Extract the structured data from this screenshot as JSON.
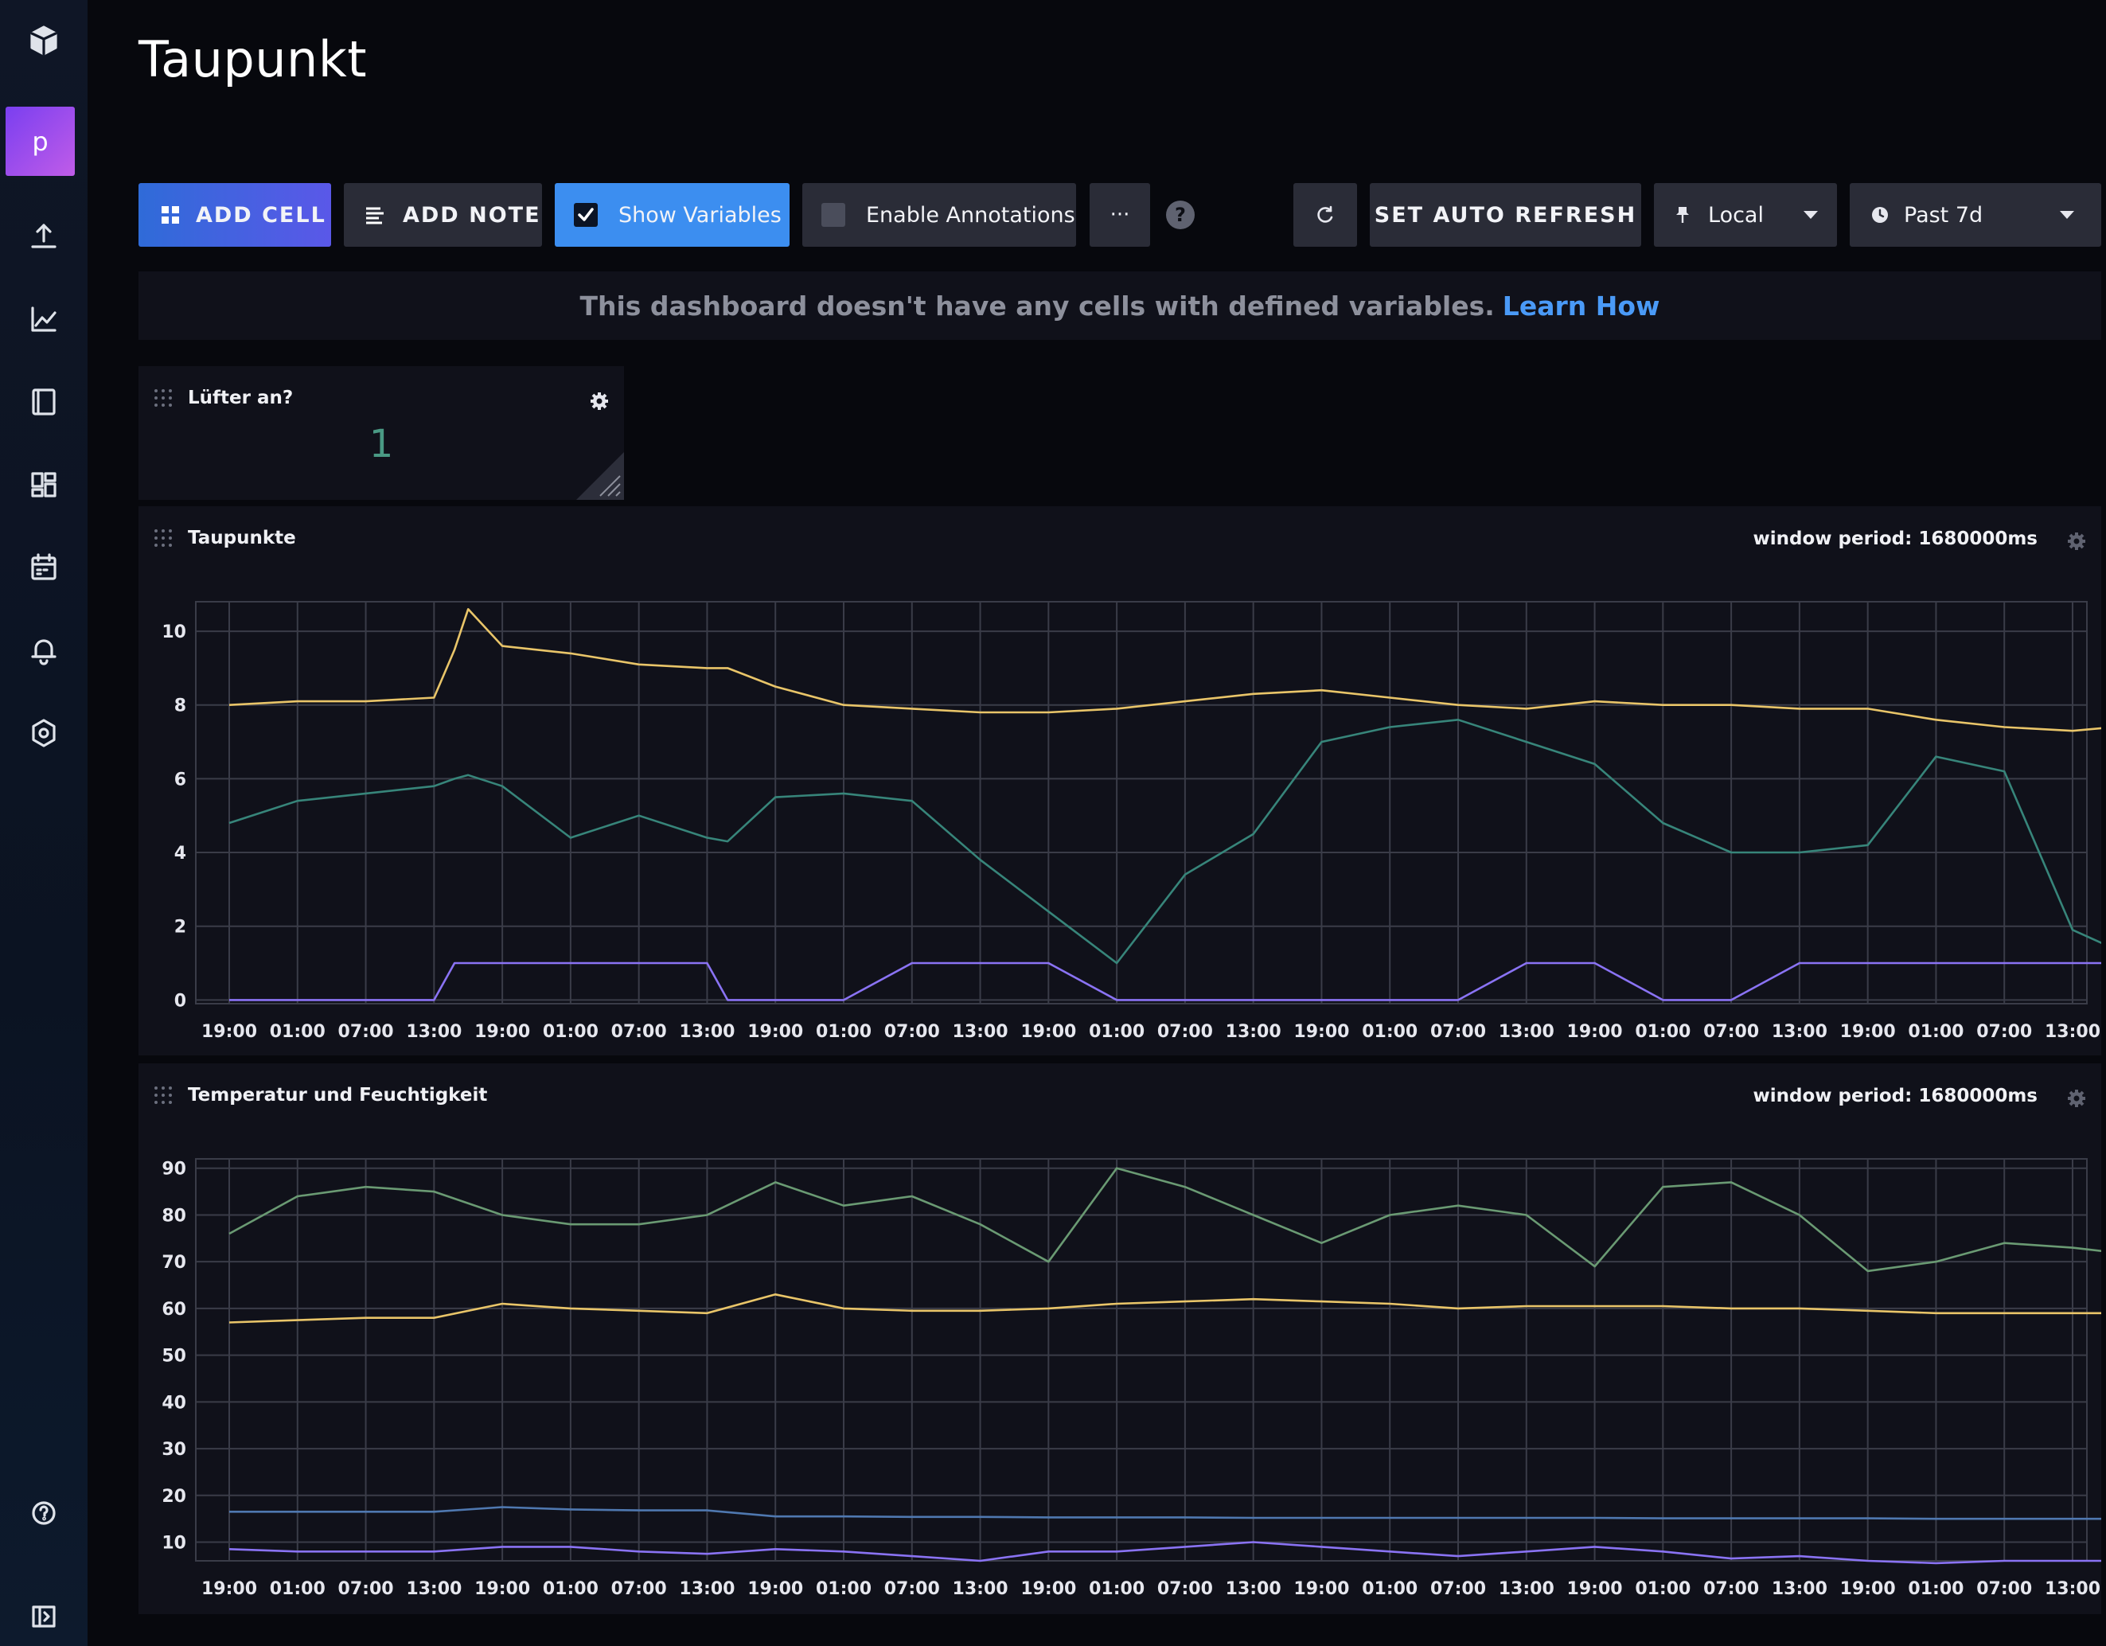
{
  "page": {
    "title": "Taupunkt"
  },
  "sidebar": {
    "org_initial": "p",
    "items": [
      {
        "name": "logo",
        "icon": "influx-logo-icon"
      },
      {
        "name": "data",
        "icon": "upload-icon"
      },
      {
        "name": "explore",
        "icon": "graph-icon"
      },
      {
        "name": "notebooks",
        "icon": "book-icon"
      },
      {
        "name": "dashboards",
        "icon": "dashboards-icon"
      },
      {
        "name": "tasks",
        "icon": "calendar-icon"
      },
      {
        "name": "alerts",
        "icon": "bell-icon"
      },
      {
        "name": "settings",
        "icon": "gear-icon"
      },
      {
        "name": "help",
        "icon": "help-icon"
      },
      {
        "name": "collapse",
        "icon": "sidebar-collapse-icon"
      }
    ]
  },
  "toolbar": {
    "add_cell": "ADD CELL",
    "add_note": "ADD NOTE",
    "show_variables": "Show Variables",
    "show_variables_checked": true,
    "enable_annotations": "Enable Annotations",
    "enable_annotations_checked": false,
    "more": "···",
    "help": "?",
    "auto_refresh": "SET AUTO REFRESH",
    "timezone": "Local",
    "time_range": "Past 7d"
  },
  "notice": {
    "text": "This dashboard doesn't have any cells with defined variables.",
    "link": "Learn How"
  },
  "cells": {
    "fan": {
      "title": "Lüfter an?",
      "value": "1",
      "value_color": "#4a9a84"
    },
    "dew": {
      "title": "Taupunkte",
      "window_period": "window period: 1680000ms"
    },
    "temp": {
      "title": "Temperatur und Feuchtigkeit",
      "window_period": "window period: 1680000ms"
    }
  },
  "colors": {
    "yellow": "#e9c569",
    "teal": "#37857a",
    "purple": "#8a73f4",
    "green": "#6a9a73",
    "blue": "#4f78b0",
    "grid": "#3a3c48",
    "axis_text": "#e6e7ee"
  },
  "chart_data": [
    {
      "type": "line",
      "title": "Taupunkte",
      "xlabel": "",
      "ylabel": "",
      "x_ticks": [
        "19:00",
        "01:00",
        "07:00",
        "13:00",
        "19:00",
        "01:00",
        "07:00",
        "13:00",
        "19:00",
        "01:00",
        "07:00",
        "13:00",
        "19:00",
        "01:00",
        "07:00",
        "13:00",
        "19:00",
        "01:00",
        "07:00",
        "13:00",
        "19:00",
        "01:00",
        "07:00",
        "13:00",
        "19:00",
        "01:00",
        "07:00",
        "13:00"
      ],
      "y_ticks": [
        0,
        2,
        4,
        6,
        8,
        10
      ],
      "ylim": [
        -0.1,
        10.8
      ],
      "x": [
        0,
        1,
        2,
        3,
        3.3,
        3.5,
        4,
        5,
        6,
        7,
        7.3,
        8,
        9,
        10,
        11,
        12,
        13,
        14,
        15,
        16,
        17,
        18,
        19,
        20,
        21,
        22,
        23,
        24,
        25,
        26,
        27,
        27.6
      ],
      "series": [
        {
          "color": "#e9c569",
          "values": [
            8.0,
            8.1,
            8.1,
            8.2,
            9.5,
            10.6,
            9.6,
            9.4,
            9.1,
            9.0,
            9.0,
            8.5,
            8.0,
            7.9,
            7.8,
            7.8,
            7.9,
            8.1,
            8.3,
            8.4,
            8.2,
            8.0,
            7.9,
            8.1,
            8.0,
            8.0,
            7.9,
            7.9,
            7.6,
            7.4,
            7.3,
            7.4
          ]
        },
        {
          "color": "#37857a",
          "values": [
            4.8,
            5.4,
            5.6,
            5.8,
            6.0,
            6.1,
            5.8,
            4.4,
            5.0,
            4.4,
            4.3,
            5.5,
            5.6,
            5.4,
            3.8,
            2.4,
            1.0,
            3.4,
            4.5,
            7.0,
            7.4,
            7.6,
            7.0,
            6.4,
            4.8,
            4.0,
            4.0,
            4.2,
            6.6,
            6.2,
            1.9,
            1.4
          ]
        },
        {
          "color": "#8a73f4",
          "values": [
            0,
            0,
            0,
            0,
            1,
            1,
            1,
            1,
            1,
            1,
            0,
            0,
            0,
            1,
            1,
            1,
            0,
            0,
            0,
            0,
            0,
            0,
            1,
            1,
            0,
            0,
            1,
            1,
            1,
            1,
            1,
            1
          ]
        }
      ]
    },
    {
      "type": "line",
      "title": "Temperatur und Feuchtigkeit",
      "xlabel": "",
      "ylabel": "",
      "x_ticks": [
        "19:00",
        "01:00",
        "07:00",
        "13:00",
        "19:00",
        "01:00",
        "07:00",
        "13:00",
        "19:00",
        "01:00",
        "07:00",
        "13:00",
        "19:00",
        "01:00",
        "07:00",
        "13:00",
        "19:00",
        "01:00",
        "07:00",
        "13:00",
        "19:00",
        "01:00",
        "07:00",
        "13:00",
        "19:00",
        "01:00",
        "07:00",
        "13:00"
      ],
      "y_ticks": [
        10,
        20,
        30,
        40,
        50,
        60,
        70,
        80,
        90
      ],
      "ylim": [
        6,
        92
      ],
      "x": [
        0,
        1,
        2,
        3,
        4,
        5,
        6,
        7,
        8,
        9,
        10,
        11,
        12,
        13,
        14,
        15,
        16,
        17,
        18,
        19,
        20,
        21,
        22,
        23,
        24,
        25,
        26,
        27,
        27.6
      ],
      "series": [
        {
          "color": "#6a9a73",
          "values": [
            76,
            84,
            86,
            85,
            80,
            78,
            78,
            80,
            87,
            82,
            84,
            78,
            70,
            90,
            86,
            80,
            74,
            80,
            82,
            80,
            69,
            86,
            87,
            80,
            68,
            70,
            74,
            73,
            72
          ]
        },
        {
          "color": "#e9c569",
          "values": [
            57,
            57.5,
            58,
            58,
            61,
            60,
            59.5,
            59,
            63,
            60,
            59.5,
            59.5,
            60,
            61,
            61.5,
            62,
            61.5,
            61,
            60,
            60.5,
            60.5,
            60.5,
            60,
            60,
            59.5,
            59,
            59,
            59,
            59
          ]
        },
        {
          "color": "#4f78b0",
          "values": [
            16.5,
            16.5,
            16.5,
            16.5,
            17.5,
            17,
            16.8,
            16.8,
            15.5,
            15.5,
            15.4,
            15.4,
            15.3,
            15.3,
            15.3,
            15.2,
            15.2,
            15.2,
            15.2,
            15.2,
            15.2,
            15.1,
            15.1,
            15.1,
            15.1,
            15.0,
            15.0,
            15.0,
            15.0
          ]
        },
        {
          "color": "#8a73f4",
          "values": [
            8.5,
            8,
            8,
            8,
            9,
            9,
            8,
            7.5,
            8.5,
            8,
            7,
            6,
            8,
            8,
            9,
            10,
            9,
            8,
            7,
            8,
            9,
            8,
            6.5,
            7,
            6,
            5.5,
            6,
            6,
            6
          ]
        }
      ]
    }
  ]
}
